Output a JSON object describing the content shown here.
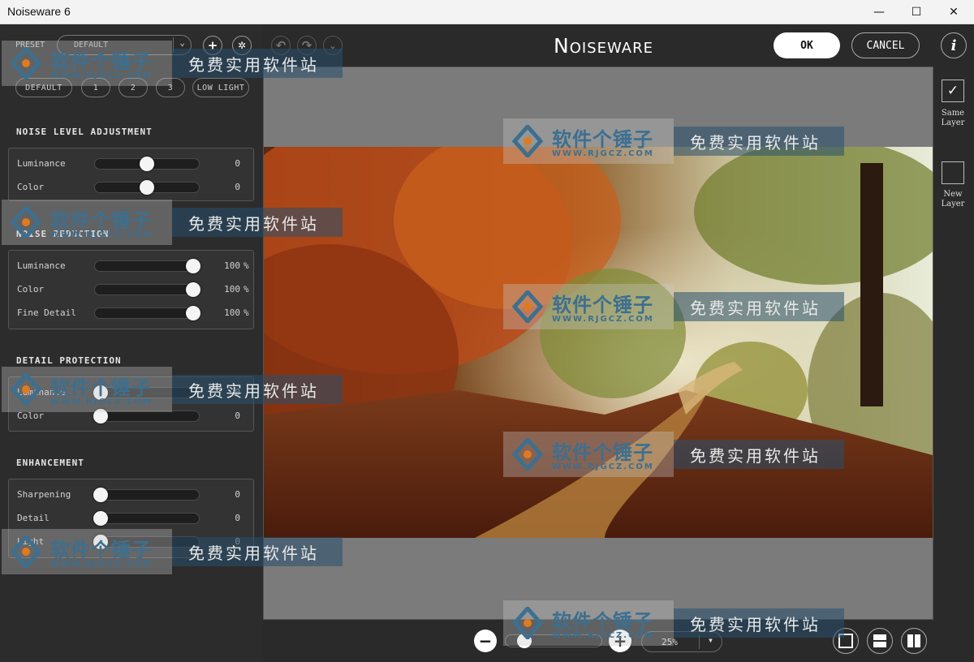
{
  "window": {
    "title": "Noiseware 6",
    "minimize": "—",
    "maximize": "☐",
    "close": "✕"
  },
  "preset": {
    "label": "PRESET",
    "value": "DEFAULT",
    "add": "+",
    "settings": "✲",
    "undo": "↶",
    "redo": "↷",
    "buttons": [
      "DEFAULT",
      "1",
      "2",
      "3",
      "LOW LIGHT"
    ]
  },
  "noise_level": {
    "title": "NOISE LEVEL ADJUSTMENT",
    "sliders": [
      {
        "label": "Luminance",
        "value": "0",
        "unit": "",
        "level": 0.5
      },
      {
        "label": "Color",
        "value": "0",
        "unit": "",
        "level": 0.5
      }
    ]
  },
  "noise_reduction": {
    "title": "NOISE REDUCTION",
    "sliders": [
      {
        "label": "Luminance",
        "value": "100",
        "unit": "%",
        "level": 1.0
      },
      {
        "label": "Color",
        "value": "100",
        "unit": "%",
        "level": 1.0
      },
      {
        "label": "Fine Detail",
        "value": "100",
        "unit": "%",
        "level": 1.0
      }
    ]
  },
  "detail_protection": {
    "title": "DETAIL PROTECTION",
    "sliders": [
      {
        "label": "Luminance",
        "value": "0",
        "unit": "",
        "level": 0.0
      },
      {
        "label": "Color",
        "value": "0",
        "unit": "",
        "level": 0.0
      }
    ]
  },
  "enhancement": {
    "title": "ENHANCEMENT",
    "sliders": [
      {
        "label": "Sharpening",
        "value": "0",
        "unit": "",
        "level": 0.0
      },
      {
        "label": "Detail",
        "value": "0",
        "unit": "",
        "level": 0.0
      },
      {
        "label": "Light",
        "value": "0",
        "unit": "",
        "level": 0.0
      }
    ]
  },
  "header": {
    "brand": "Noiseware",
    "ok": "OK",
    "cancel": "CANCEL",
    "info": "i"
  },
  "layers": {
    "same": "Same Layer",
    "new": "New Layer",
    "same_checked": "✓"
  },
  "zoom": {
    "minus": "−",
    "plus": "+",
    "value": "25%",
    "level": 0.15,
    "dropdown": "▾"
  },
  "watermark": {
    "cn": "软件个锤子",
    "url": "WWW.RJGCZ.COM",
    "slogan": "免费实用软件站"
  }
}
